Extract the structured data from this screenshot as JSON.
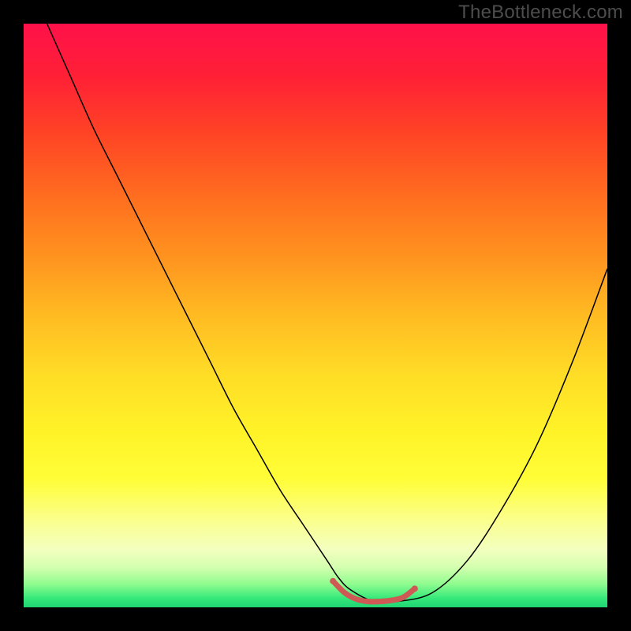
{
  "watermark": "TheBottleneck.com",
  "chart_data": {
    "type": "line",
    "title": "",
    "xlabel": "",
    "ylabel": "",
    "xlim": [
      0,
      100
    ],
    "ylim": [
      0,
      100
    ],
    "gradient": {
      "stops": [
        {
          "offset": 0.0,
          "color": "#ff114a"
        },
        {
          "offset": 0.09,
          "color": "#ff2036"
        },
        {
          "offset": 0.19,
          "color": "#ff4425"
        },
        {
          "offset": 0.3,
          "color": "#ff6f1f"
        },
        {
          "offset": 0.4,
          "color": "#ff931f"
        },
        {
          "offset": 0.5,
          "color": "#ffbb22"
        },
        {
          "offset": 0.6,
          "color": "#ffdc26"
        },
        {
          "offset": 0.7,
          "color": "#fff328"
        },
        {
          "offset": 0.78,
          "color": "#fffd37"
        },
        {
          "offset": 0.85,
          "color": "#fbff8c"
        },
        {
          "offset": 0.9,
          "color": "#f3ffbf"
        },
        {
          "offset": 0.93,
          "color": "#d6ffb0"
        },
        {
          "offset": 0.96,
          "color": "#90fc8f"
        },
        {
          "offset": 0.985,
          "color": "#34e87a"
        },
        {
          "offset": 1.0,
          "color": "#1fd472"
        }
      ]
    },
    "series": [
      {
        "name": "bottleneck-curve",
        "color": "#000000",
        "width": 1.5,
        "x": [
          4,
          8,
          12,
          16,
          20,
          24,
          28,
          32,
          36,
          40,
          44,
          48,
          52,
          54,
          56,
          60,
          64,
          70,
          76,
          82,
          88,
          94,
          100
        ],
        "y": [
          100,
          91,
          82,
          74,
          66,
          58,
          50,
          42,
          34,
          27,
          20,
          14,
          8,
          5,
          3,
          1,
          1,
          2.5,
          8,
          17,
          28,
          42,
          58
        ]
      },
      {
        "name": "optimal-band",
        "color": "#cf5a55",
        "width": 7,
        "capStyle": "round",
        "x": [
          53,
          55,
          57,
          59,
          61,
          63,
          65,
          67
        ],
        "y": [
          4.5,
          2.5,
          1.4,
          1.0,
          1.0,
          1.2,
          1.7,
          3.2
        ]
      }
    ],
    "markers": [
      {
        "name": "optimal-start",
        "x": 53,
        "y": 4.5,
        "r": 4,
        "color": "#cf5a55"
      },
      {
        "name": "optimal-end",
        "x": 67,
        "y": 3.2,
        "r": 4,
        "color": "#cf5a55"
      }
    ]
  }
}
